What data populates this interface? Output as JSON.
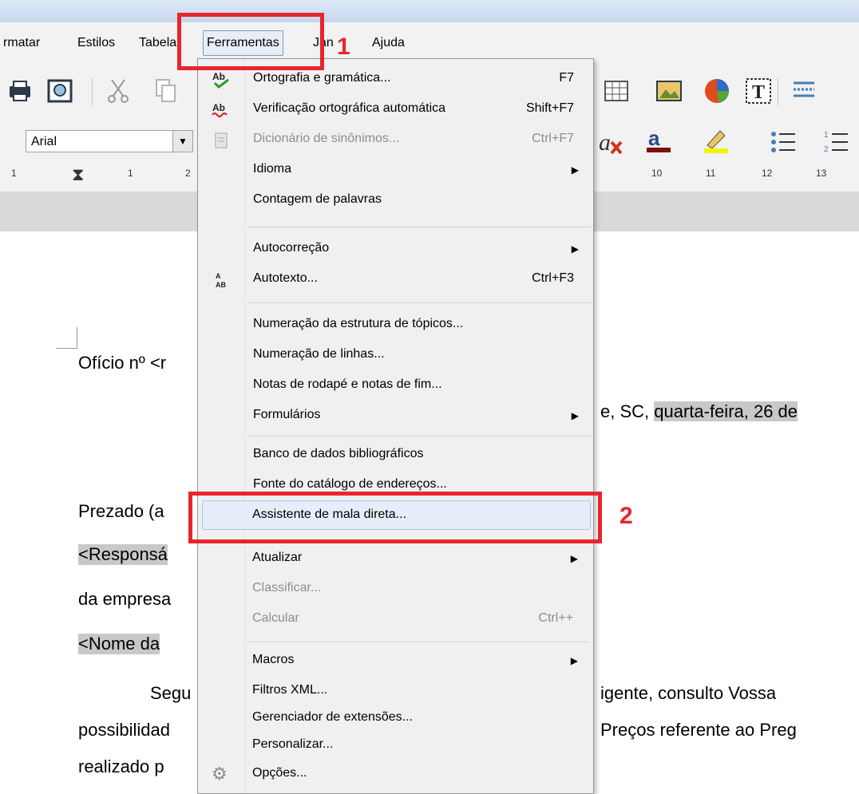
{
  "menubar": {
    "items": [
      {
        "label": "rmatar"
      },
      {
        "label": "Estilos"
      },
      {
        "label": "Tabela"
      },
      {
        "label": "Ferramentas"
      },
      {
        "label": "Jan"
      },
      {
        "label": "Ajuda"
      }
    ]
  },
  "font_box": {
    "value": "Arial"
  },
  "ruler": {
    "ticks": [
      "1",
      "1",
      "2",
      "10",
      "11",
      "12",
      "13"
    ]
  },
  "document": {
    "line1": "Ofício nº <r",
    "line2": "e, SC, ",
    "line2_hl": "quarta-feira, 26 de",
    "line3": "Prezado (a",
    "line4": "<Responsá",
    "line5": "da empresa",
    "line6": "<Nome da",
    "line7a": "Segu",
    "line7b": "igente, consulto Vossa",
    "line8a": "possibilidad",
    "line8b": "Preços referente ao Preg",
    "line9": "realizado p"
  },
  "menu": {
    "items": [
      {
        "label": "Ortografia e gramática...",
        "key": "F7",
        "icon": "spellcheck-icon"
      },
      {
        "label": "Verificação ortográfica automática",
        "key": "Shift+F7",
        "icon": "autospell-icon"
      },
      {
        "label": "Dicionário de sinônimos...",
        "key": "Ctrl+F7",
        "icon": "thesaurus-icon",
        "disabled": true
      },
      {
        "label": "Idioma",
        "submenu": true
      },
      {
        "label": "Contagem de palavras"
      },
      {
        "label": "Autocorreção",
        "submenu": true
      },
      {
        "label": "Autotexto...",
        "key": "Ctrl+F3",
        "icon": "autotext-icon"
      },
      {
        "label": "Numeração da estrutura de tópicos..."
      },
      {
        "label": "Numeração de linhas..."
      },
      {
        "label": "Notas de rodapé e notas de fim..."
      },
      {
        "label": "Formulários",
        "submenu": true
      },
      {
        "label": "Banco de dados bibliográficos"
      },
      {
        "label": "Fonte do catálogo de endereços..."
      },
      {
        "label": "Assistente de mala direta...",
        "highlighted": true
      },
      {
        "label": "Atualizar",
        "submenu": true
      },
      {
        "label": "Classificar...",
        "disabled": true
      },
      {
        "label": "Calcular",
        "key": "Ctrl++",
        "disabled": true
      },
      {
        "label": "Macros",
        "submenu": true
      },
      {
        "label": "Filtros XML..."
      },
      {
        "label": "Gerenciador de extensões..."
      },
      {
        "label": "Personalizar..."
      },
      {
        "label": "Opções...",
        "icon": "gear-icon"
      }
    ]
  },
  "annotations": {
    "step1": "1",
    "step2": "2"
  },
  "colors": {
    "annotation_red": "#e8252d",
    "menu_hover": "#e5eef9"
  }
}
